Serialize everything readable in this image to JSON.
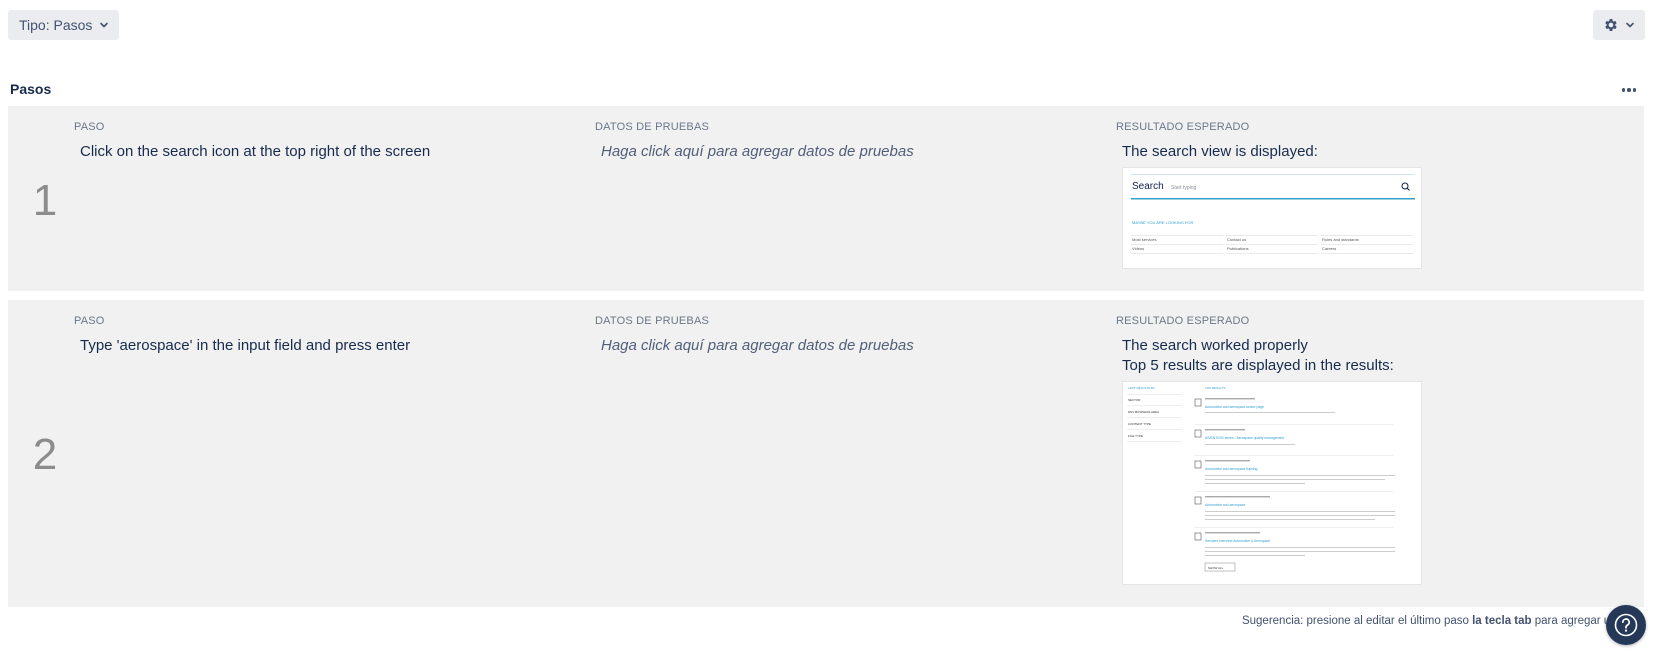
{
  "toolbar": {
    "type_filter_label": "Tipo: Pasos",
    "type_filter_icon": "chevron-down-icon",
    "settings_icon": "gear-icon"
  },
  "section": {
    "title": "Pasos",
    "more_icon": "more-horizontal-icon"
  },
  "columns": {
    "paso": "PASO",
    "datos": "DATOS DE PRUEBAS",
    "resultado": "RESULTADO ESPERADO"
  },
  "steps": [
    {
      "number": "1",
      "action": "Click on the search icon at the top right of the screen",
      "data": "Haga click aquí para agregar datos de pruebas",
      "result_lines": [
        "The search view is displayed:"
      ],
      "thumbnail": {
        "search_title": "Search",
        "search_placeholder": "Start typing",
        "section_label": "MAYBE YOU ARE LOOKING FOR",
        "links": [
          "Most services",
          "Contact us",
          "Rules and standards",
          "Videos",
          "Publications",
          "Careers"
        ]
      }
    },
    {
      "number": "2",
      "action": "Type 'aerospace' in the input field and press enter",
      "data": "Haga click aquí para agregar datos de pruebas",
      "result_lines": [
        "The search worked properly",
        "Top 5 results are displayed in the results:"
      ],
      "thumbnail": {
        "filter_title": "LIMIT RESULTS BY",
        "filters": [
          "SECTOR",
          "DNV BUSINESS AREA",
          "CONTENT TYPE",
          "FILE TYPE"
        ],
        "results_title": "TOP RESULTS",
        "results": [
          "Automotive and aerospace sector page",
          "AS/EN 9100 series - Aerospace quality management",
          "Automotive and aerospace training",
          "Automotive and aerospace",
          "Services overview Automotive & Aerospace"
        ],
        "load_more": "SHOW ALL"
      }
    }
  ],
  "footer": {
    "hint_prefix": "Sugerencia: presione al editar el último paso ",
    "hint_key": "la tecla tab",
    "hint_suffix": " para agregar uno",
    "help_icon": "help-icon"
  }
}
